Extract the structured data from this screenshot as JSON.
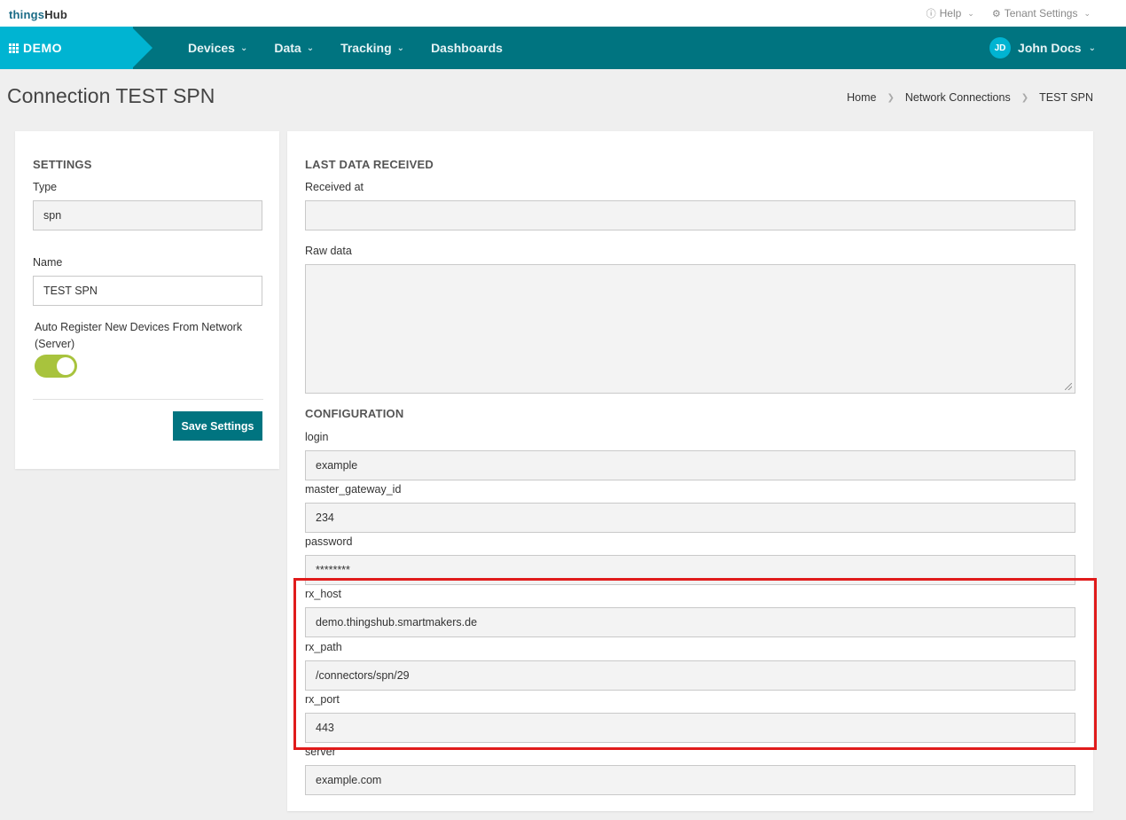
{
  "app": {
    "logo_prefix": "things",
    "logo_suffix": "Hub"
  },
  "top_links": [
    {
      "label": "Help",
      "icon": "help-circle-icon"
    },
    {
      "label": "Tenant Settings",
      "icon": "gear-icon"
    }
  ],
  "nav": {
    "brand": "DEMO",
    "items": [
      {
        "label": "Devices",
        "has_dropdown": true
      },
      {
        "label": "Data",
        "has_dropdown": true
      },
      {
        "label": "Tracking",
        "has_dropdown": true
      },
      {
        "label": "Dashboards",
        "has_dropdown": false
      }
    ],
    "user": {
      "initials": "JD",
      "name": "John Docs"
    }
  },
  "page": {
    "title": "Connection TEST SPN",
    "breadcrumb": [
      "Home",
      "Network Connections",
      "TEST SPN"
    ]
  },
  "settings": {
    "title": "SETTINGS",
    "type_label": "Type",
    "type_value": "spn",
    "name_label": "Name",
    "name_value": "TEST SPN",
    "auto_register_label": "Auto Register New Devices From Network (Server)",
    "auto_register_on": true,
    "save_label": "Save Settings"
  },
  "last_data": {
    "title": "LAST DATA RECEIVED",
    "received_at_label": "Received at",
    "received_at_value": "",
    "raw_data_label": "Raw data",
    "raw_data_value": ""
  },
  "configuration": {
    "title": "CONFIGURATION",
    "fields": [
      {
        "label": "login",
        "value": "example"
      },
      {
        "label": "master_gateway_id",
        "value": "234"
      },
      {
        "label": "password",
        "value": "********"
      },
      {
        "label": "rx_host",
        "value": "demo.thingshub.smartmakers.de"
      },
      {
        "label": "rx_path",
        "value": "/connectors/spn/29"
      },
      {
        "label": "rx_port",
        "value": "443"
      },
      {
        "label": "server",
        "value": "example.com"
      }
    ]
  },
  "colors": {
    "nav_bg": "#007480",
    "brand_bg": "#00b4d2",
    "toggle_on": "#a8c33d",
    "highlight": "#e01b1b"
  }
}
